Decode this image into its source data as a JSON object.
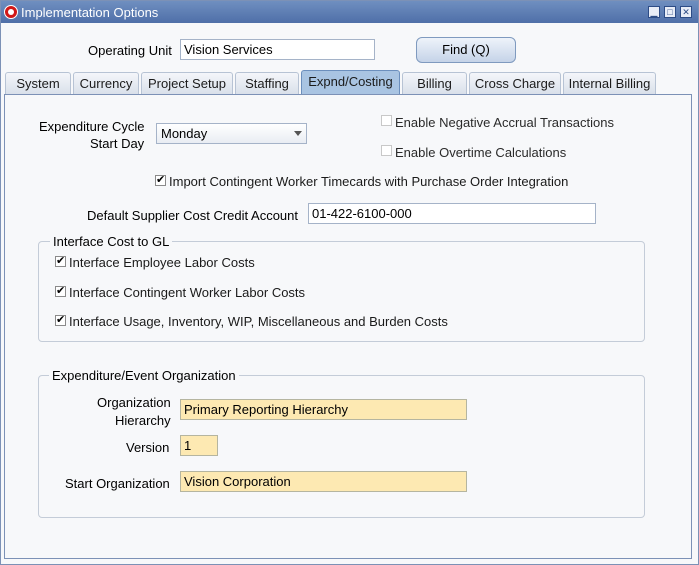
{
  "window": {
    "title": "Implementation Options"
  },
  "header": {
    "operating_unit_label": "Operating Unit",
    "operating_unit_value": "Vision Services",
    "find_button": "Find (Q)"
  },
  "tabs": [
    {
      "label": "System"
    },
    {
      "label": "Currency"
    },
    {
      "label": "Project Setup"
    },
    {
      "label": "Staffing"
    },
    {
      "label": "Expnd/Costing"
    },
    {
      "label": "Billing"
    },
    {
      "label": "Cross Charge"
    },
    {
      "label": "Internal Billing"
    }
  ],
  "costing": {
    "cycle_label_line1": "Expenditure Cycle",
    "cycle_label_line2": "Start Day",
    "cycle_value": "Monday",
    "negative_accrual_label": "Enable Negative Accrual Transactions",
    "overtime_label": "Enable Overtime Calculations",
    "import_cwk_label": "Import Contingent Worker Timecards with Purchase Order Integration",
    "supplier_account_label": "Default Supplier Cost Credit Account",
    "supplier_account_value": "01-422-6100-000"
  },
  "interface_gl": {
    "title": "Interface Cost to GL",
    "employee_labor": "Interface Employee Labor Costs",
    "cwk_labor": "Interface Contingent Worker Labor Costs",
    "usage_costs": "Interface Usage, Inventory, WIP, Miscellaneous and Burden Costs"
  },
  "event_org": {
    "title": "Expenditure/Event Organization",
    "hierarchy_label_line1": "Organization",
    "hierarchy_label_line2": "Hierarchy",
    "hierarchy_value": "Primary Reporting Hierarchy",
    "version_label": "Version",
    "version_value": "1",
    "start_org_label": "Start Organization",
    "start_org_value": "Vision Corporation"
  }
}
